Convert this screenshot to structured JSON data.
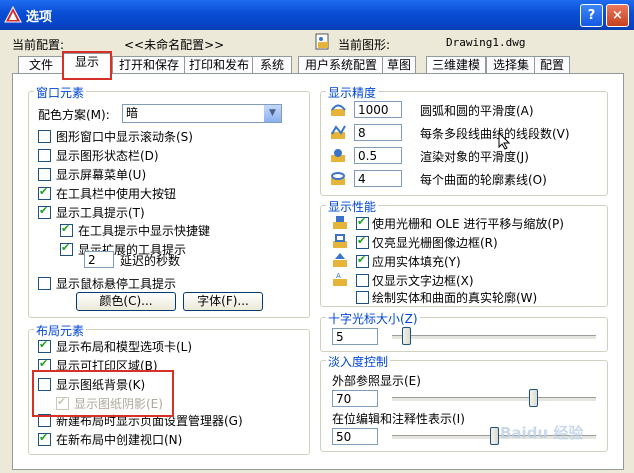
{
  "window": {
    "title": "选项",
    "help": "?",
    "close": "×"
  },
  "header": {
    "current_profile_label": "当前配置:",
    "current_profile_value": "<<未命名配置>>",
    "current_drawing_label": "当前图形:",
    "current_drawing_value": "Drawing1.dwg"
  },
  "tabs": [
    "文件",
    "显示",
    "打开和保存",
    "打印和发布",
    "系统",
    "用户系统配置",
    "草图",
    "三维建模",
    "选择集",
    "配置"
  ],
  "active_tab": "显示",
  "window_elements": {
    "title": "窗口元素",
    "color_scheme_label": "配色方案(M):",
    "color_scheme_value": "暗",
    "checkboxes": [
      {
        "label": "图形窗口中显示滚动条(S)",
        "checked": false
      },
      {
        "label": "显示图形状态栏(D)",
        "checked": false
      },
      {
        "label": "显示屏幕菜单(U)",
        "checked": false
      },
      {
        "label": "在工具栏中使用大按钮",
        "checked": true
      },
      {
        "label": "显示工具提示(T)",
        "checked": true
      },
      {
        "label": "在工具提示中显示快捷键",
        "checked": true
      },
      {
        "label": "显示扩展的工具提示",
        "checked": true
      }
    ],
    "delay_value": "2",
    "delay_label": "延迟的秒数",
    "rollover_label": "显示鼠标悬停工具提示",
    "rollover_checked": false,
    "colors_button": "颜色(C)...",
    "fonts_button": "字体(F)..."
  },
  "layout_elements": {
    "title": "布局元素",
    "checkboxes": [
      {
        "label": "显示布局和模型选项卡(L)",
        "checked": true,
        "disabled": false
      },
      {
        "label": "显示可打印区域(B)",
        "checked": true,
        "disabled": false
      },
      {
        "label": "显示图纸背景(K)",
        "checked": false,
        "disabled": false
      },
      {
        "label": "显示图纸阴影(E)",
        "checked": true,
        "disabled": true
      },
      {
        "label": "新建布局时显示页面设置管理器(G)",
        "checked": false,
        "disabled": false
      },
      {
        "label": "在新布局中创建视口(N)",
        "checked": true,
        "disabled": false
      }
    ]
  },
  "display_resolution": {
    "title": "显示精度",
    "rows": [
      {
        "value": "1000",
        "label": "圆弧和圆的平滑度(A)"
      },
      {
        "value": "8",
        "label": "每条多段线曲线的线段数(V)"
      },
      {
        "value": "0.5",
        "label": "渲染对象的平滑度(J)"
      },
      {
        "value": "4",
        "label": "每个曲面的轮廓素线(O)"
      }
    ]
  },
  "display_performance": {
    "title": "显示性能",
    "rows": [
      {
        "label": "使用光栅和 OLE 进行平移与缩放(P)",
        "checked": true,
        "icon": true
      },
      {
        "label": "仅亮显光栅图像边框(R)",
        "checked": true,
        "icon": true
      },
      {
        "label": "应用实体填充(Y)",
        "checked": true,
        "icon": true
      },
      {
        "label": "仅显示文字边框(X)",
        "checked": false,
        "icon": true
      },
      {
        "label": "绘制实体和曲面的真实轮廓(W)",
        "checked": false,
        "icon": false
      }
    ]
  },
  "crosshair": {
    "title": "十字光标大小(Z)",
    "value": "5",
    "level_percent": 5
  },
  "fade_control": {
    "title": "淡入度控制",
    "xref_label": "外部参照显示(E)",
    "xref_value": "70",
    "xref_percent": 70,
    "inplace_label": "在位编辑和注释性表示(I)",
    "inplace_value": "50",
    "inplace_percent": 50
  },
  "watermark": "Baidu 经验",
  "colors": {
    "title_bar": "#0a4fd6",
    "group_title": "#0046d5",
    "highlight_box": "#d63029",
    "dialog_bg": "#ece9d8"
  }
}
